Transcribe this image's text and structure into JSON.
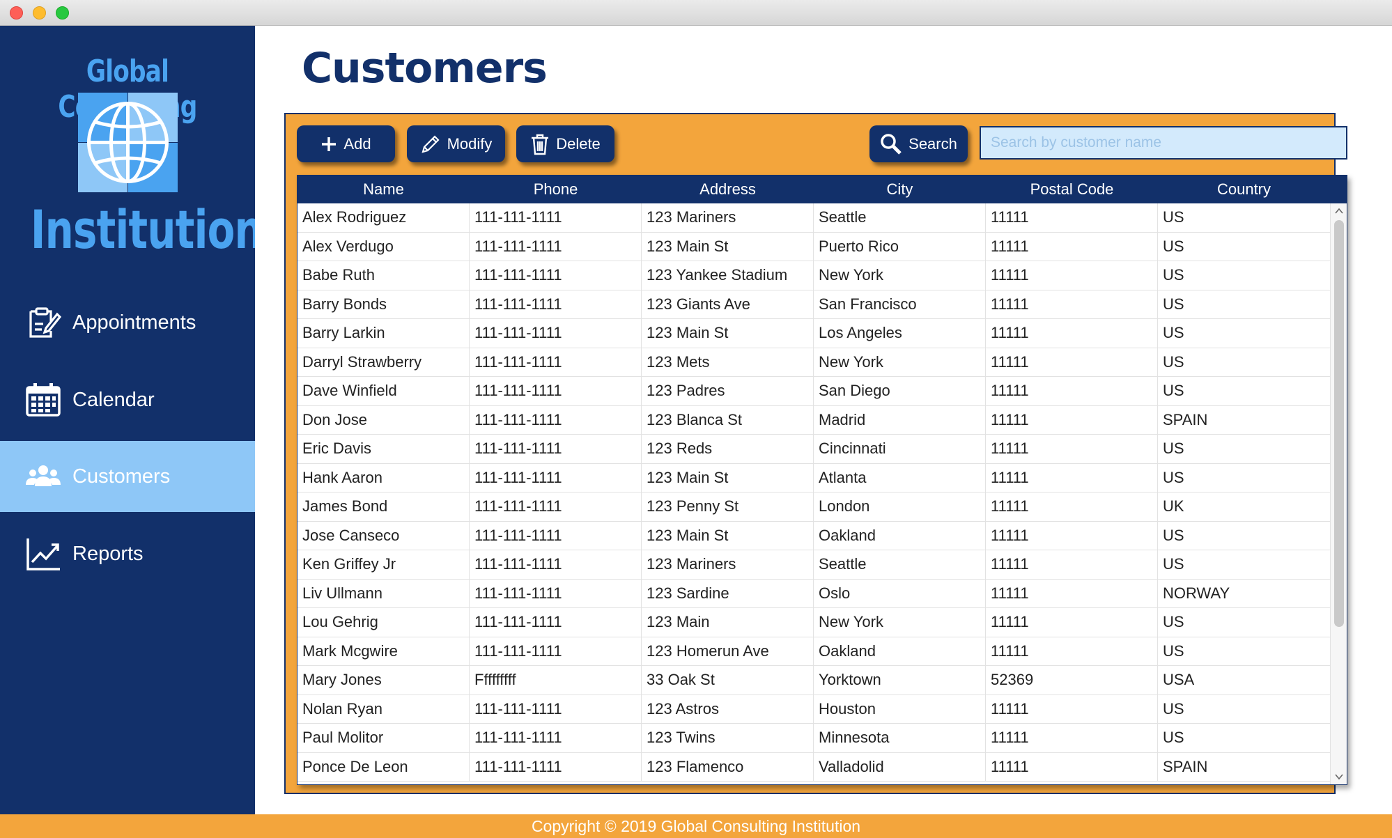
{
  "sidebar": {
    "brand_line1": "Global Consulting",
    "brand_line2": "Institution",
    "items": [
      {
        "label": "Appointments",
        "icon": "clipboard-edit-icon",
        "active": false
      },
      {
        "label": "Calendar",
        "icon": "calendar-icon",
        "active": false
      },
      {
        "label": "Customers",
        "icon": "users-icon",
        "active": true
      },
      {
        "label": "Reports",
        "icon": "chart-line-icon",
        "active": false
      }
    ]
  },
  "main": {
    "title": "Customers"
  },
  "toolbar": {
    "add_label": "Add",
    "modify_label": "Modify",
    "delete_label": "Delete",
    "search_label": "Search",
    "search_placeholder": "Search by customer name"
  },
  "table": {
    "columns": [
      "Name",
      "Phone",
      "Address",
      "City",
      "Postal Code",
      "Country"
    ],
    "rows": [
      [
        "Alex Rodriguez",
        "111-111-1111",
        "123 Mariners",
        "Seattle",
        "11111",
        "US"
      ],
      [
        "Alex Verdugo",
        "111-111-1111",
        "123 Main St",
        "Puerto Rico",
        "11111",
        "US"
      ],
      [
        "Babe Ruth",
        "111-111-1111",
        "123 Yankee Stadium",
        "New York",
        "11111",
        "US"
      ],
      [
        "Barry Bonds",
        "111-111-1111",
        "123 Giants Ave",
        "San Francisco",
        "11111",
        "US"
      ],
      [
        "Barry Larkin",
        "111-111-1111",
        "123 Main St",
        "Los Angeles",
        "11111",
        "US"
      ],
      [
        "Darryl Strawberry",
        "111-111-1111",
        "123 Mets",
        "New York",
        "11111",
        "US"
      ],
      [
        "Dave Winfield",
        "111-111-1111",
        "123 Padres",
        "San Diego",
        "11111",
        "US"
      ],
      [
        "Don Jose",
        "111-111-1111",
        "123 Blanca St",
        "Madrid",
        "11111",
        "SPAIN"
      ],
      [
        "Eric Davis",
        "111-111-1111",
        "123 Reds",
        "Cincinnati",
        "11111",
        "US"
      ],
      [
        "Hank Aaron",
        "111-111-1111",
        "123 Main St",
        "Atlanta",
        "11111",
        "US"
      ],
      [
        "James Bond",
        "111-111-1111",
        "123 Penny St",
        "London",
        "11111",
        "UK"
      ],
      [
        "Jose Canseco",
        "111-111-1111",
        "123 Main St",
        "Oakland",
        "11111",
        "US"
      ],
      [
        "Ken Griffey Jr",
        "111-111-1111",
        "123 Mariners",
        "Seattle",
        "11111",
        "US"
      ],
      [
        "Liv Ullmann",
        "111-111-1111",
        "123 Sardine",
        "Oslo",
        "11111",
        "NORWAY"
      ],
      [
        "Lou Gehrig",
        "111-111-1111",
        "123 Main",
        "New York",
        "11111",
        "US"
      ],
      [
        "Mark Mcgwire",
        "111-111-1111",
        "123 Homerun Ave",
        "Oakland",
        "11111",
        "US"
      ],
      [
        "Mary Jones",
        "Fffffffff",
        "33 Oak St",
        "Yorktown",
        "52369",
        "USA"
      ],
      [
        "Nolan Ryan",
        "111-111-1111",
        "123 Astros",
        "Houston",
        "11111",
        "US"
      ],
      [
        "Paul Molitor",
        "111-111-1111",
        "123 Twins",
        "Minnesota",
        "11111",
        "US"
      ],
      [
        "Ponce De Leon",
        "111-111-1111",
        "123 Flamenco",
        "Valladolid",
        "11111",
        "SPAIN"
      ]
    ]
  },
  "footer": {
    "text": "Copyright © 2019 Global Consulting Institution"
  },
  "colors": {
    "navy": "#12306a",
    "orange": "#f3a53c",
    "active_nav": "#8ec7f7",
    "brand_blue": "#4aa3f0"
  }
}
